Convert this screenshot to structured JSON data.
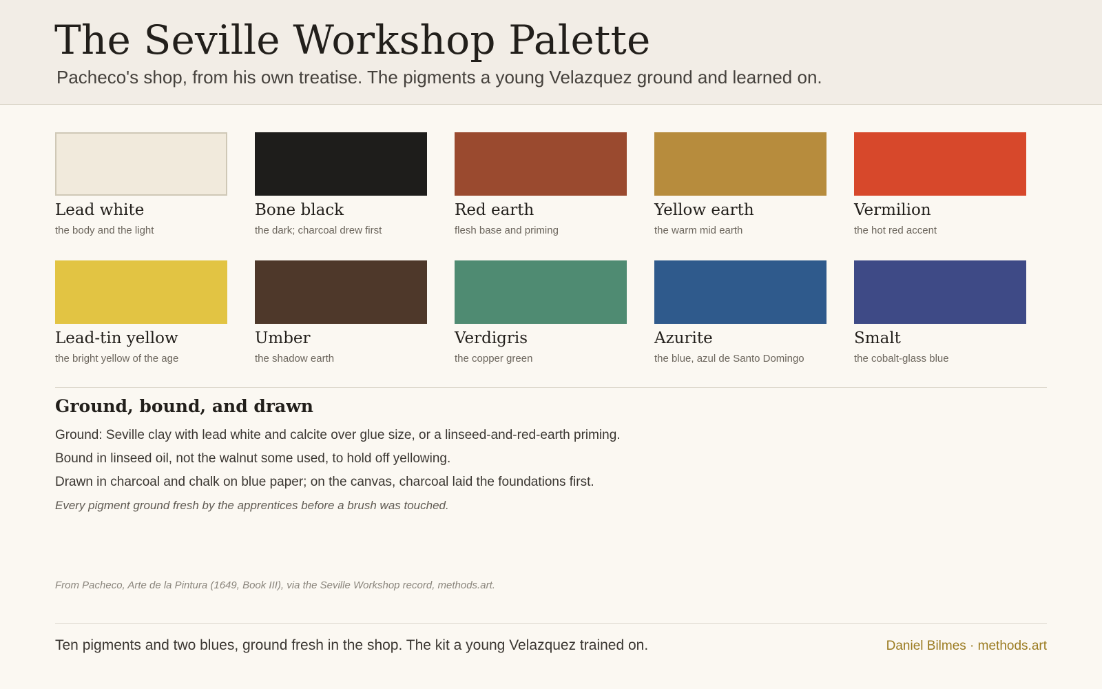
{
  "header": {
    "title": "The Seville Workshop Palette",
    "subtitle": "Pacheco's shop, from his own treatise. The pigments a young Velazquez ground and learned on."
  },
  "pigments": [
    {
      "name": "Lead white",
      "desc": "the body and the light",
      "color": "#f1eadc"
    },
    {
      "name": "Bone black",
      "desc": "the dark; charcoal drew first",
      "color": "#1e1d1b"
    },
    {
      "name": "Red earth",
      "desc": "flesh base and priming",
      "color": "#9a4a2f"
    },
    {
      "name": "Yellow earth",
      "desc": "the warm mid earth",
      "color": "#b78c3d"
    },
    {
      "name": "Vermilion",
      "desc": "the hot red accent",
      "color": "#d7482b"
    },
    {
      "name": "Lead-tin yellow",
      "desc": "the bright yellow of the age",
      "color": "#e2c443"
    },
    {
      "name": "Umber",
      "desc": "the shadow earth",
      "color": "#4e382a"
    },
    {
      "name": "Verdigris",
      "desc": "the copper green",
      "color": "#4f8b72"
    },
    {
      "name": "Azurite",
      "desc": "the blue, azul de Santo Domingo",
      "color": "#2f5a8c"
    },
    {
      "name": "Smalt",
      "desc": "the cobalt-glass blue",
      "color": "#3e4a86"
    }
  ],
  "section": {
    "title": "Ground, bound, and drawn",
    "lines": [
      "Ground: Seville clay with lead white and calcite over glue size, or a linseed-and-red-earth priming.",
      "Bound in linseed oil, not the walnut some used, to hold off yellowing.",
      "Drawn in charcoal and chalk on blue paper; on the canvas, charcoal laid the foundations first."
    ],
    "note": "Every pigment ground fresh by the apprentices before a brush was touched."
  },
  "source": "From Pacheco, Arte de la Pintura (1649, Book III), via the Seville Workshop record, methods.art.",
  "footer": {
    "text": "Ten pigments and two blues, ground fresh in the shop. The kit a young Velazquez trained on.",
    "credit": "Daniel Bilmes · methods.art"
  }
}
